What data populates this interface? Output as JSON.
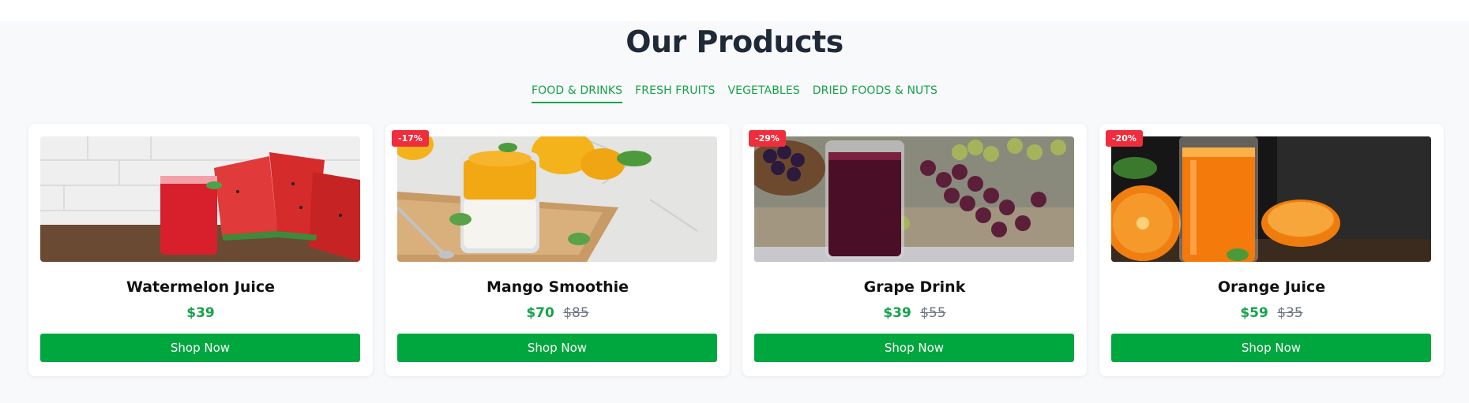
{
  "section": {
    "title": "Our Products"
  },
  "tabs": [
    {
      "label": "FOOD & DRINKS",
      "active": true
    },
    {
      "label": "FRESH FRUITS",
      "active": false
    },
    {
      "label": "VEGETABLES",
      "active": false
    },
    {
      "label": "DRIED FOODS & NUTS",
      "active": false
    }
  ],
  "products": [
    {
      "name": "Watermelon Juice",
      "price": "$39",
      "old_price": "",
      "badge": "",
      "button_label": "Shop Now",
      "image": "watermelon-juice-photo"
    },
    {
      "name": "Mango Smoothie",
      "price": "$70",
      "old_price": "$85",
      "badge": "-17%",
      "button_label": "Shop Now",
      "image": "mango-smoothie-photo"
    },
    {
      "name": "Grape Drink",
      "price": "$39",
      "old_price": "$55",
      "badge": "-29%",
      "button_label": "Shop Now",
      "image": "grape-drink-photo"
    },
    {
      "name": "Orange Juice",
      "price": "$59",
      "old_price": "$35",
      "badge": "-20%",
      "button_label": "Shop Now",
      "image": "orange-juice-photo"
    }
  ],
  "colors": {
    "accent": "#16a34a",
    "button": "#00a63e",
    "badge": "#ef2d3c",
    "title": "#1f2937",
    "background": "#f8f9fa"
  }
}
